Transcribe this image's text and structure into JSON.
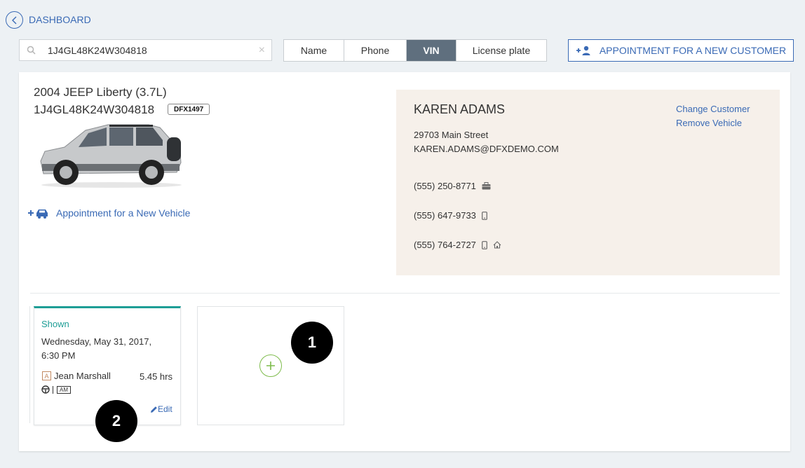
{
  "nav": {
    "back_label": "DASHBOARD"
  },
  "search": {
    "value": "1J4GL48K24W304818",
    "clear_glyph": "×"
  },
  "filters": [
    {
      "label": "Name",
      "active": false
    },
    {
      "label": "Phone",
      "active": false
    },
    {
      "label": "VIN",
      "active": true
    },
    {
      "label": "License plate",
      "active": false
    }
  ],
  "new_customer_button": "APPOINTMENT FOR A NEW CUSTOMER",
  "vehicle": {
    "title": "2004 JEEP Liberty (3.7L)",
    "vin": "1J4GL48K24W304818",
    "plate": "DFX1497",
    "new_vehicle_link": "Appointment for a New Vehicle"
  },
  "customer": {
    "name": "KAREN ADAMS",
    "address": "29703 Main Street",
    "email": "KAREN.ADAMS@DFXDEMO.COM",
    "change_link": "Change Customer",
    "remove_link": "Remove Vehicle",
    "phones": [
      {
        "number": "(555) 250-8771",
        "icons": [
          "briefcase-icon"
        ]
      },
      {
        "number": "(555) 647-9733",
        "icons": [
          "mobile-icon"
        ]
      },
      {
        "number": "(555) 764-2727",
        "icons": [
          "mobile-icon",
          "home-icon"
        ]
      }
    ]
  },
  "appointment": {
    "status": "Shown",
    "date_line1": "Wednesday, May 31, 2017,",
    "date_line2": "6:30 PM",
    "tech_badge": "A",
    "technician": "Jean Marshall",
    "hours": "5.45 hrs",
    "period_badge": "AM",
    "edit_label": "Edit"
  },
  "markers": {
    "one": "1",
    "two": "2"
  },
  "colors": {
    "accent": "#3a6ab5",
    "teal": "#1e9e96",
    "add_green": "#7dbb4a",
    "active_seg": "#5f6f7e",
    "customer_panel": "#f6f0ea"
  }
}
